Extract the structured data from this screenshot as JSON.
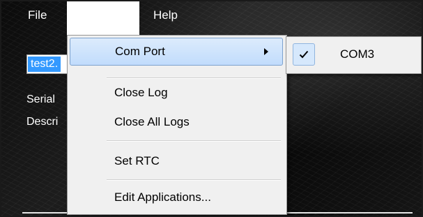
{
  "menubar": {
    "file_label": "File",
    "help_label": "Help"
  },
  "background": {
    "file_field_value": "test2.",
    "serial_label": "Serial",
    "description_label": "Descri"
  },
  "dropdown": {
    "items": [
      {
        "label": "Com Port",
        "has_submenu": true,
        "highlighted": true
      },
      {
        "label": "Close Log"
      },
      {
        "label": "Close All Logs"
      },
      {
        "label": "Set RTC"
      },
      {
        "label": "Edit Applications..."
      }
    ]
  },
  "submenu": {
    "items": [
      {
        "label": "COM3",
        "checked": true
      }
    ]
  },
  "colors": {
    "highlight": "#c1dcfc",
    "selection": "#3399ff"
  }
}
